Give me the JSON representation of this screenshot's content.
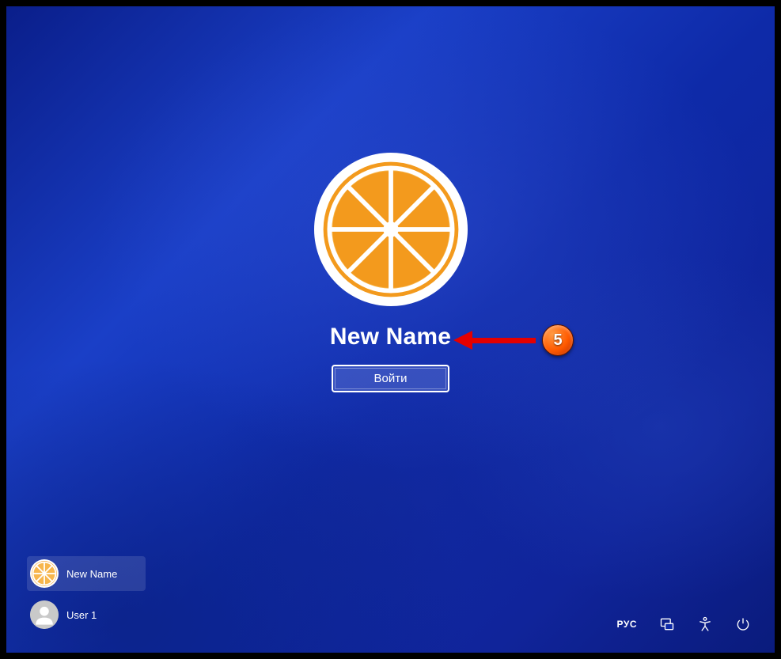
{
  "active_user": {
    "name": "New Name",
    "avatar_kind": "orange-slice"
  },
  "signin_button_label": "Войти",
  "user_list": [
    {
      "name": "New Name",
      "avatar_kind": "orange-slice",
      "selected": true
    },
    {
      "name": "User 1",
      "avatar_kind": "generic-person",
      "selected": false
    }
  ],
  "tray": {
    "language": "РУС"
  },
  "annotation": {
    "step_number": "5"
  }
}
